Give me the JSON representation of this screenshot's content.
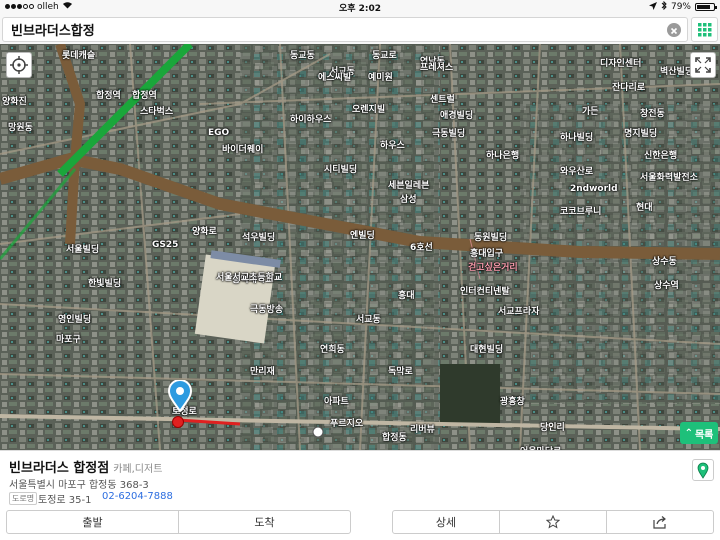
{
  "status": {
    "carrier": "olleh",
    "time": "오후 2:02",
    "battery": "79%",
    "battery_level": 0.79
  },
  "search": {
    "query": "빈브라더스합정"
  },
  "map": {
    "labels": [
      {
        "text": "롯데캐슬",
        "pink": false
      },
      {
        "text": "합정역",
        "pink": false
      },
      {
        "text": "동교동",
        "pink": false
      },
      {
        "text": "서교동",
        "pink": false
      },
      {
        "text": "동교로",
        "pink": false
      },
      {
        "text": "연남동",
        "pink": false
      },
      {
        "text": "에스씨빌",
        "pink": false
      },
      {
        "text": "예미원",
        "pink": false
      },
      {
        "text": "오렌지빌",
        "pink": false
      },
      {
        "text": "하이하우스",
        "pink": false
      },
      {
        "text": "프레셔스",
        "pink": false
      },
      {
        "text": "센트럴",
        "pink": false
      },
      {
        "text": "애경빌딩",
        "pink": false
      },
      {
        "text": "EGO",
        "pink": false
      },
      {
        "text": "바이더웨이",
        "pink": false
      },
      {
        "text": "스타벅스",
        "pink": false
      },
      {
        "text": "세븐일레븐",
        "pink": false
      },
      {
        "text": "GS25",
        "pink": false
      },
      {
        "text": "마포구",
        "pink": false
      },
      {
        "text": "상수동",
        "pink": false
      },
      {
        "text": "홍익대학교",
        "pink": false
      },
      {
        "text": "와우산로",
        "pink": false
      },
      {
        "text": "인터컨티넨탈",
        "pink": false
      },
      {
        "text": "하나빌딩",
        "pink": false
      },
      {
        "text": "시티빌딩",
        "pink": false
      },
      {
        "text": "양화로",
        "pink": false
      },
      {
        "text": "서울서교초등학교",
        "pink": false
      },
      {
        "text": "6호선",
        "pink": false
      },
      {
        "text": "상수역",
        "pink": false
      },
      {
        "text": "극동방송",
        "pink": false
      },
      {
        "text": "연희동",
        "pink": false
      },
      {
        "text": "2ndworld",
        "pink": false
      },
      {
        "text": "홍대입구",
        "pink": false
      },
      {
        "text": "서교동",
        "pink": false
      },
      {
        "text": "합정동",
        "pink": false
      },
      {
        "text": "토정로",
        "pink": false
      },
      {
        "text": "독막로",
        "pink": false
      },
      {
        "text": "어울마당로",
        "pink": false
      },
      {
        "text": "잔다리로",
        "pink": false
      },
      {
        "text": "서울빌딩",
        "pink": false
      },
      {
        "text": "한빛빌딩",
        "pink": false
      },
      {
        "text": "하나은행",
        "pink": false
      },
      {
        "text": "신한은행",
        "pink": false
      },
      {
        "text": "당인리",
        "pink": false
      },
      {
        "text": "영인빌딩",
        "pink": false
      },
      {
        "text": "석우빌딩",
        "pink": false
      },
      {
        "text": "동원빌딩",
        "pink": false
      },
      {
        "text": "서울화력발전소",
        "pink": false
      },
      {
        "text": "엔빌딩",
        "pink": false
      },
      {
        "text": "디자인센터",
        "pink": false
      },
      {
        "text": "합정역",
        "pink": false
      },
      {
        "text": "양화진",
        "pink": false
      },
      {
        "text": "하우스",
        "pink": false
      },
      {
        "text": "아파트",
        "pink": false
      },
      {
        "text": "푸르지오",
        "pink": false
      },
      {
        "text": "리버뷰",
        "pink": false
      },
      {
        "text": "광흥창",
        "pink": false
      },
      {
        "text": "창전동",
        "pink": false
      },
      {
        "text": "망원동",
        "pink": false
      },
      {
        "text": "현대",
        "pink": false
      },
      {
        "text": "벽산빌딩",
        "pink": false
      },
      {
        "text": "홍대",
        "pink": false
      },
      {
        "text": "대현빌딩",
        "pink": false
      },
      {
        "text": "삼성",
        "pink": false
      },
      {
        "text": "극동빌딩",
        "pink": false
      },
      {
        "text": "가든",
        "pink": false
      },
      {
        "text": "명지빌딩",
        "pink": false
      },
      {
        "text": "걷고싶은거리",
        "pink": true
      },
      {
        "text": "서교프라자",
        "pink": false
      },
      {
        "text": "코코브루니",
        "pink": false
      },
      {
        "text": "만리재",
        "pink": false
      }
    ],
    "list_button": "목록"
  },
  "place": {
    "name": "빈브라더스 합정점",
    "category": "카페,디저트",
    "address": "서울특별시 마포구 합정동 368-3",
    "road_tag": "도로명",
    "road_address": "토정로 35-1",
    "phone": "02-6204-7888"
  },
  "actions": {
    "depart": "출발",
    "arrive": "도착",
    "detail": "상세"
  },
  "colors": {
    "accent": "#1ec07a",
    "phone": "#2d6ee0",
    "marker": "#2d9be0",
    "pin_red": "#e02020"
  }
}
